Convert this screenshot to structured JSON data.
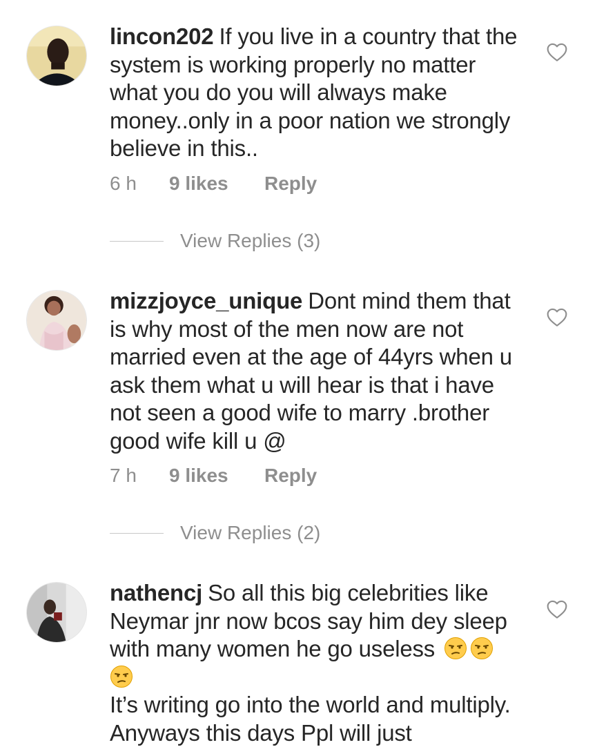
{
  "comments": [
    {
      "username": "lincon202",
      "text": "If you live in a country that the system is working properly no matter what you do you will always make money..only in a poor nation we strongly believe in this..",
      "time": "6 h",
      "likes": "9 likes",
      "reply": "Reply",
      "view_replies": "View Replies (3)",
      "avatar_icon": "user-avatar-icon"
    },
    {
      "username": "mizzjoyce_unique",
      "text": "Dont mind them that is why most of the men now are not married even at the age of 44yrs when u ask them what u will hear is that i have not seen a good wife to marry .brother good wife kill u @",
      "time": "7 h",
      "likes": "9 likes",
      "reply": "Reply",
      "view_replies": "View Replies (2)",
      "avatar_icon": "user-avatar-icon"
    },
    {
      "username": "nathencj",
      "text_part1": "So all this big celebrities like Neymar jnr now bcos say him dey sleep with many women he go useless",
      "emoji_name": "unamused-face-emoji",
      "text_part2": "It’s writing go into the world and multiply. Anyways this days Ppl will just",
      "avatar_icon": "user-avatar-icon"
    }
  ],
  "icons": {
    "like": "heart-outline-icon"
  },
  "colors": {
    "primary_text": "#262626",
    "secondary_text": "#8e8e8e",
    "divider": "#c7c7c7"
  }
}
